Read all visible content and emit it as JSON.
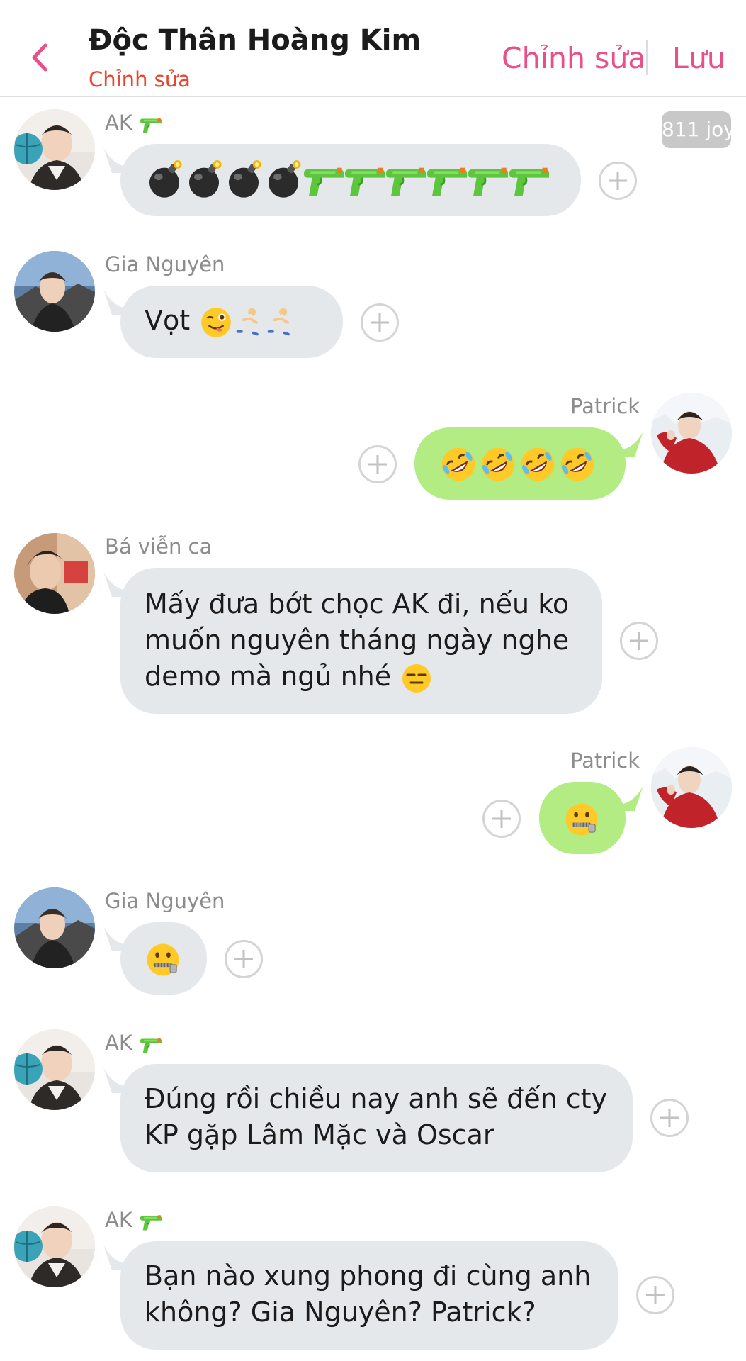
{
  "header": {
    "title": "Độc Thân Hoàng Kim",
    "subtitle": "Chỉnh sửa",
    "edit_label": "Chỉnh sửa",
    "save_label": "Lưu",
    "back_icon": "chevron-left-icon",
    "accent_color": "#e8508a"
  },
  "joy_badge": "811 joy",
  "colors": {
    "incoming_bubble": "#e5e8ea",
    "outgoing_bubble": "#b3ec83"
  },
  "messages": [
    {
      "sender": "AK",
      "direction": "incoming",
      "emojis": [
        "bomb",
        "bomb",
        "bomb",
        "bomb",
        "water-pistol",
        "water-pistol",
        "water-pistol",
        "water-pistol",
        "water-pistol",
        "water-pistol"
      ]
    },
    {
      "sender": "Gia Nguyên",
      "direction": "incoming",
      "text": "Vọt",
      "emojis": [
        "winking-face-with-tongue",
        "person-running",
        "person-running"
      ]
    },
    {
      "sender": "Patrick",
      "direction": "outgoing",
      "emojis": [
        "rolling-on-floor-laughing",
        "rolling-on-floor-laughing",
        "rolling-on-floor-laughing",
        "rolling-on-floor-laughing"
      ]
    },
    {
      "sender": "Bá viễn ca",
      "direction": "incoming",
      "lines": [
        "Mấy đưa bớt chọc AK đi, nếu ko",
        "muốn nguyên tháng ngày nghe",
        "demo mà ngủ nhé"
      ],
      "emojis": [
        "expressionless-face"
      ]
    },
    {
      "sender": "Patrick",
      "direction": "outgoing",
      "emojis": [
        "zipper-mouth-face"
      ]
    },
    {
      "sender": "Gia Nguyên",
      "direction": "incoming",
      "emojis": [
        "zipper-mouth-face"
      ]
    },
    {
      "sender": "AK",
      "direction": "incoming",
      "lines": [
        "Đúng rồi chiều nay anh sẽ đến cty",
        "KP gặp Lâm Mặc và Oscar"
      ]
    },
    {
      "sender": "AK",
      "direction": "incoming",
      "lines": [
        "Bạn nào xung phong đi cùng anh",
        "không? Gia Nguyên? Patrick?"
      ]
    }
  ]
}
